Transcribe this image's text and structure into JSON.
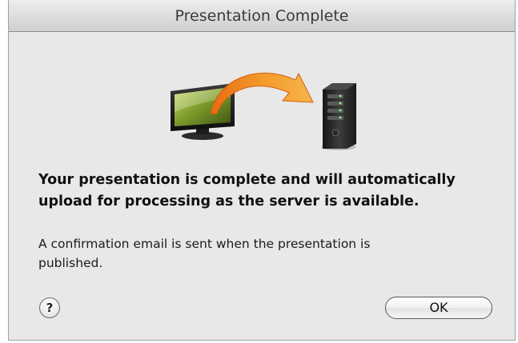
{
  "window": {
    "title": "Presentation Complete"
  },
  "illustration": {
    "icons": [
      "monitor-icon",
      "upload-arrow-icon",
      "server-icon"
    ],
    "arrow_color": "#f08a1c",
    "screen_color": "#7a9a2a"
  },
  "message": {
    "headline_line1": "Your presentation is complete and will automatically",
    "headline_line2": "upload for processing as the server is available.",
    "detail_line1": "A confirmation email is sent when the presentation is",
    "detail_line2": "published."
  },
  "buttons": {
    "help_label": "?",
    "ok_label": "OK"
  }
}
